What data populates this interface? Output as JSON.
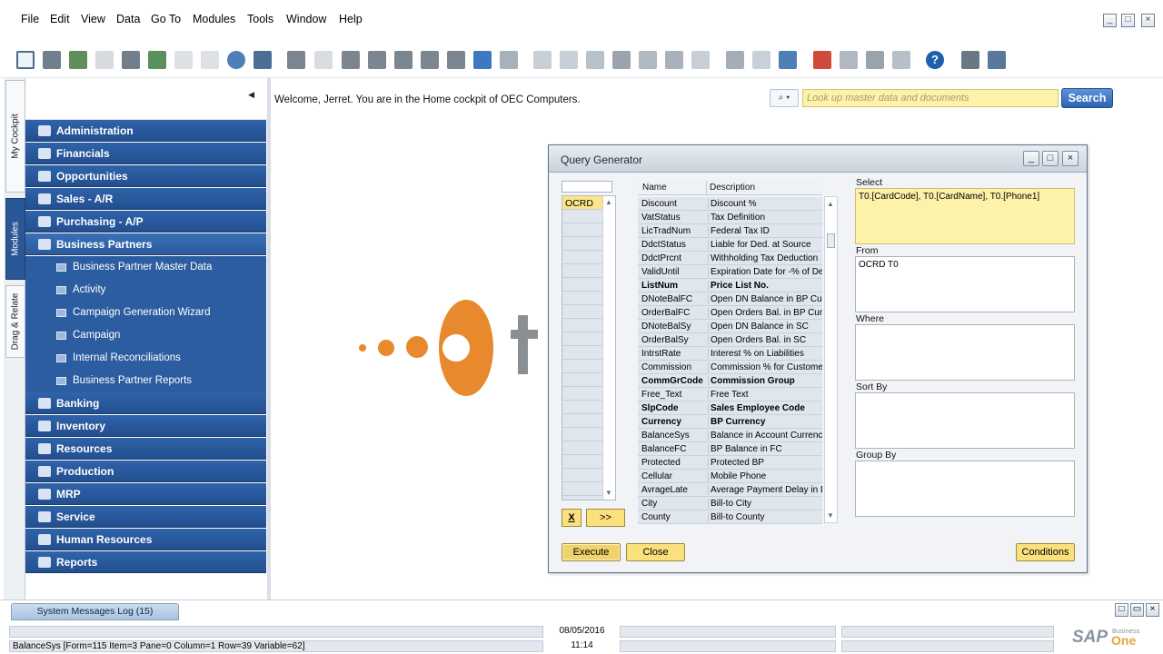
{
  "menu": [
    "File",
    "Edit",
    "View",
    "Data",
    "Go To",
    "Modules",
    "Tools",
    "Window",
    "Help"
  ],
  "vertical_tabs": [
    "My Cockpit",
    "Modules",
    "Drag & Relate"
  ],
  "modules": [
    {
      "label": "Administration",
      "icon": "administration-icon"
    },
    {
      "label": "Financials",
      "icon": "financials-icon"
    },
    {
      "label": "Opportunities",
      "icon": "opportunities-icon"
    },
    {
      "label": "Sales - A/R",
      "icon": "sales-tag-icon"
    },
    {
      "label": "Purchasing - A/P",
      "icon": "shopping-cart-icon"
    },
    {
      "label": "Business Partners",
      "icon": "business-partners-icon"
    }
  ],
  "bp_subitems": [
    "Business Partner Master Data",
    "Activity",
    "Campaign Generation Wizard",
    "Campaign",
    "Internal Reconciliations",
    "Business Partner Reports"
  ],
  "modules_after": [
    {
      "label": "Banking",
      "icon": "banking-icon"
    },
    {
      "label": "Inventory",
      "icon": "inventory-icon"
    },
    {
      "label": "Resources",
      "icon": "resources-icon"
    },
    {
      "label": "Production",
      "icon": "production-gear-icon"
    },
    {
      "label": "MRP",
      "icon": "mrp-icon"
    },
    {
      "label": "Service",
      "icon": "service-wrench-icon"
    },
    {
      "label": "Human Resources",
      "icon": "human-resources-icon"
    },
    {
      "label": "Reports",
      "icon": "reports-icon"
    }
  ],
  "cockpit": {
    "welcome": "Welcome, Jerret. You are in the Home cockpit of OEC Computers.",
    "search_placeholder": "Look up master data and documents",
    "search_button": "Search"
  },
  "query_generator": {
    "title": "Query Generator",
    "tables": [
      "OCRD"
    ],
    "columns": {
      "name": "Name",
      "description": "Description"
    },
    "fields": [
      {
        "name": "Discount",
        "desc": "Discount %",
        "bold": false
      },
      {
        "name": "VatStatus",
        "desc": "Tax Definition",
        "bold": false
      },
      {
        "name": "LicTradNum",
        "desc": "Federal Tax ID",
        "bold": false
      },
      {
        "name": "DdctStatus",
        "desc": "Liable for Ded. at Source",
        "bold": false
      },
      {
        "name": "DdctPrcnt",
        "desc": "Withholding Tax Deduction",
        "bold": false
      },
      {
        "name": "ValidUntil",
        "desc": "Expiration Date for -% of De",
        "bold": false
      },
      {
        "name": "ListNum",
        "desc": "Price List No.",
        "bold": true
      },
      {
        "name": "DNoteBalFC",
        "desc": "Open DN Balance in BP Curr",
        "bold": false
      },
      {
        "name": "OrderBalFC",
        "desc": "Open Orders Bal. in BP Curr",
        "bold": false
      },
      {
        "name": "DNoteBalSy",
        "desc": "Open DN Balance in SC",
        "bold": false
      },
      {
        "name": "OrderBalSy",
        "desc": "Open Orders Bal. in SC",
        "bold": false
      },
      {
        "name": "IntrstRate",
        "desc": "Interest % on Liabilities",
        "bold": false
      },
      {
        "name": "Commission",
        "desc": "Commission % for Customer",
        "bold": false
      },
      {
        "name": "CommGrCode",
        "desc": "Commission Group",
        "bold": true
      },
      {
        "name": "Free_Text",
        "desc": "Free Text",
        "bold": false
      },
      {
        "name": "SlpCode",
        "desc": "Sales Employee Code",
        "bold": true
      },
      {
        "name": "Currency",
        "desc": "BP Currency",
        "bold": true
      },
      {
        "name": "BalanceSys",
        "desc": "Balance in Account Currenc",
        "bold": false
      },
      {
        "name": "BalanceFC",
        "desc": "BP Balance in FC",
        "bold": false
      },
      {
        "name": "Protected",
        "desc": "Protected BP",
        "bold": false
      },
      {
        "name": "Cellular",
        "desc": "Mobile Phone",
        "bold": false
      },
      {
        "name": "AvrageLate",
        "desc": "Average Payment Delay in D",
        "bold": false
      },
      {
        "name": "City",
        "desc": "Bill-to City",
        "bold": false
      },
      {
        "name": "County",
        "desc": "Bill-to County",
        "bold": false
      }
    ],
    "labels": {
      "select": "Select",
      "from": "From",
      "where": "Where",
      "sort_by": "Sort By",
      "group_by": "Group By"
    },
    "select_value": "T0.[CardCode], T0.[CardName], T0.[Phone1]",
    "from_value": "OCRD T0",
    "where_value": "",
    "sort_by_value": "",
    "group_by_value": "",
    "btn_x": "X",
    "btn_add": ">>",
    "btn_execute": "Execute",
    "btn_close": "Close",
    "btn_conditions": "Conditions"
  },
  "log": {
    "tab": "System Messages Log (15)"
  },
  "status": {
    "message": "BalanceSys [Form=115 Item=3 Pane=0 Column=1 Row=39 Variable=62]",
    "date": "08/05/2016",
    "time": "11:14"
  },
  "brand": {
    "sap": "SAP",
    "business": "Business",
    "one": "One"
  },
  "colors": {
    "module_blue": "#2a5796",
    "highlight_yellow": "#fbe17e",
    "logo_orange": "#e8892e"
  }
}
